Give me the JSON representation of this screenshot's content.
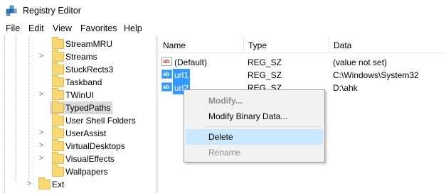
{
  "window": {
    "title": "Registry Editor",
    "icon": "registry-editor-icon"
  },
  "menu": [
    "File",
    "Edit",
    "View",
    "Favorites",
    "Help"
  ],
  "tree": {
    "items": [
      {
        "label": "StreamMRU",
        "expand": "",
        "selected": false
      },
      {
        "label": "Streams",
        "expand": ">",
        "selected": false
      },
      {
        "label": "StuckRects3",
        "expand": "",
        "selected": false
      },
      {
        "label": "Taskband",
        "expand": "",
        "selected": false
      },
      {
        "label": "TWinUI",
        "expand": ">",
        "selected": false
      },
      {
        "label": "TypedPaths",
        "expand": "",
        "selected": true
      },
      {
        "label": "User Shell Folders",
        "expand": "",
        "selected": false
      },
      {
        "label": "UserAssist",
        "expand": ">",
        "selected": false
      },
      {
        "label": "VirtualDesktops",
        "expand": ">",
        "selected": false
      },
      {
        "label": "VisualEffects",
        "expand": ">",
        "selected": false
      },
      {
        "label": "Wallpapers",
        "expand": "",
        "selected": false
      },
      {
        "label": "Ext",
        "expand": ">",
        "selected": false
      }
    ]
  },
  "list": {
    "columns": [
      "Name",
      "Type",
      "Data"
    ],
    "rows": [
      {
        "name": "(Default)",
        "type": "REG_SZ",
        "data": "(value not set)",
        "icon": "ab",
        "selected": false
      },
      {
        "name": "url1",
        "type": "REG_SZ",
        "data": "C:\\Windows\\System32",
        "icon": "ab",
        "selected": true
      },
      {
        "name": "url2",
        "type": "REG_SZ",
        "data": "D:\\ahk",
        "icon": "ab",
        "selected": true
      }
    ]
  },
  "context_menu": {
    "items": [
      {
        "label": "Modify...",
        "state": "disabled-default"
      },
      {
        "label": "Modify Binary Data...",
        "state": "enabled"
      },
      {
        "label": "Delete",
        "state": "hover"
      },
      {
        "label": "Rename",
        "state": "disabled"
      }
    ]
  },
  "colors": {
    "selection": "#3399ff",
    "menu_hover": "#cce8ff",
    "folder": "#f8d775"
  }
}
